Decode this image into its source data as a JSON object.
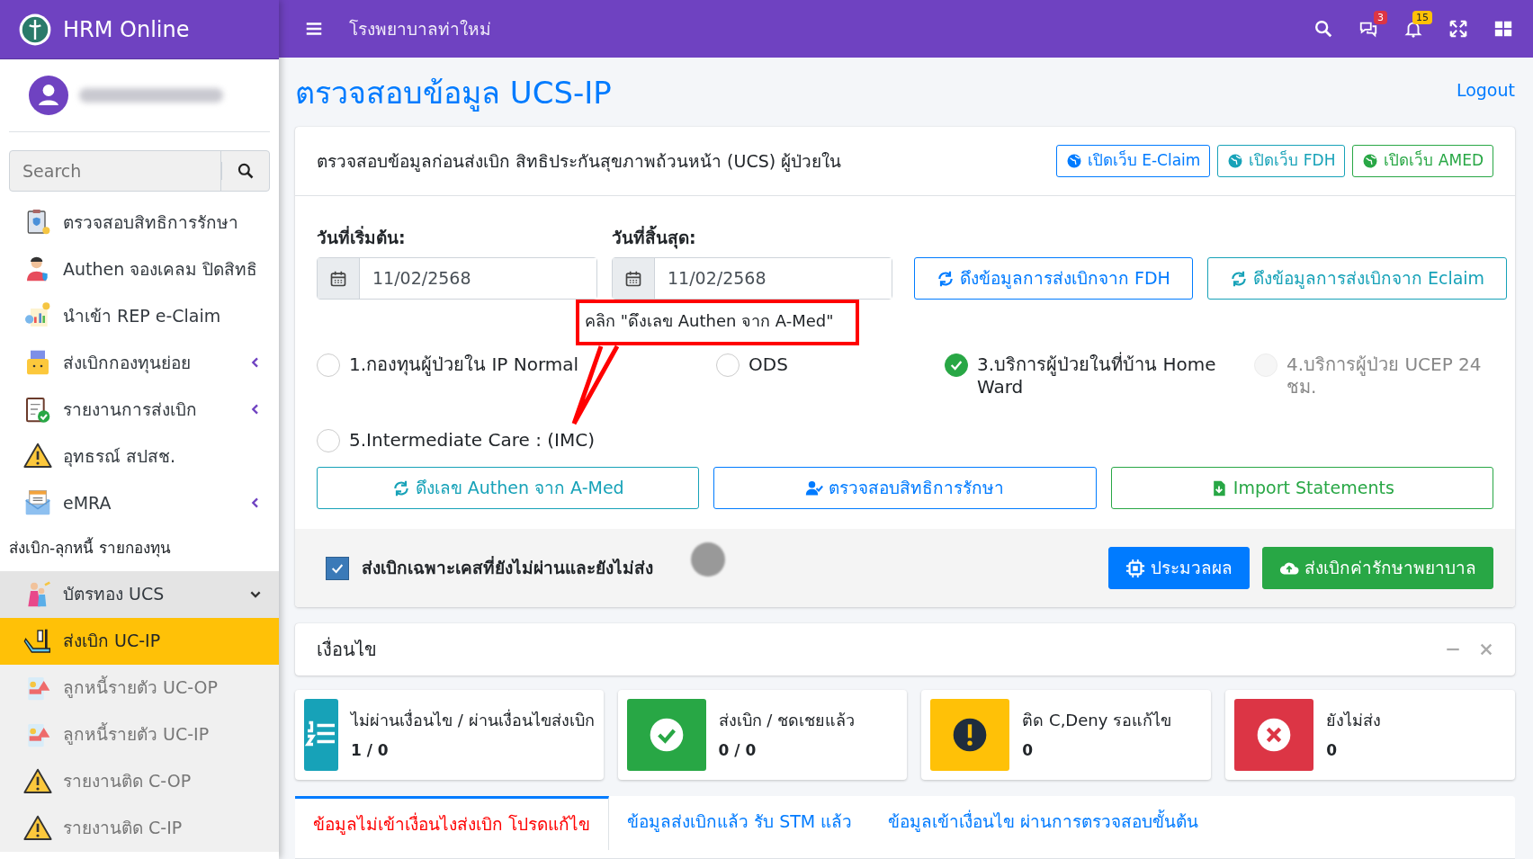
{
  "app": {
    "brand": "HRM Online",
    "hospital": "โรงพยาบาลท่าใหม่"
  },
  "topbar_icons": [
    {
      "kind": "search"
    },
    {
      "kind": "messages",
      "badge": "3",
      "color": "#dc3545"
    },
    {
      "kind": "notifications",
      "badge": "15",
      "color": "#ffc107"
    },
    {
      "kind": "fullscreen"
    },
    {
      "kind": "apps"
    }
  ],
  "sidebar": {
    "search": {
      "placeholder": "Search"
    },
    "items": [
      {
        "label": "ตรวจสอบสิทธิการรักษา",
        "kind": "clipboard"
      },
      {
        "label": "Authen จองเคลม ปิดสิทธิ",
        "kind": "person"
      },
      {
        "label": "นำเข้า REP e-Claim",
        "kind": "chart"
      },
      {
        "label": "ส่งเบิกกองทุนย่อย",
        "kind": "folder",
        "expanded": false
      },
      {
        "label": "รายงานการส่งเบิก",
        "kind": "report",
        "expanded": false
      },
      {
        "label": "อุทธรณ์ สปสช.",
        "kind": "warning"
      },
      {
        "label": "eMRA",
        "kind": "mail",
        "expanded": false
      }
    ],
    "section": "ส่งเบิก-ลุกหนี้ รายกองทุน",
    "group": {
      "label": "บัตรทอง UCS",
      "kind": "family",
      "expanded": true,
      "children": [
        {
          "label": "ส่งเบิก UC-IP",
          "kind": "bed",
          "selected": true
        },
        {
          "label": "ลูกหนี้รายตัว UC-OP",
          "kind": "debt",
          "selected": false
        },
        {
          "label": "ลูกหนี้รายตัว UC-IP",
          "kind": "debt",
          "selected": false
        },
        {
          "label": "รายงานติด C-OP",
          "kind": "warning",
          "selected": false
        },
        {
          "label": "รายงานติด C-IP",
          "kind": "warning",
          "selected": false
        }
      ]
    }
  },
  "page": {
    "title": "ตรวจสอบข้อมูล UCS-IP",
    "logout": "Logout"
  },
  "check_card": {
    "title": "ตรวจสอบข้อมูลก่อนส่งเบิก สิทธิประกันสุขภาพถ้วนหน้า (UCS) ผู้ป่วยใน",
    "links": [
      {
        "label": "เปิดเว็บ E-Claim",
        "kind": "eclaim"
      },
      {
        "label": "เปิดเว็บ FDH",
        "kind": "fdh"
      },
      {
        "label": "เปิดเว็บ AMED",
        "kind": "amed"
      }
    ],
    "start": {
      "label": "วันที่เริ่มต้น:",
      "value": "11/02/2568"
    },
    "end": {
      "label": "วันที่สิ้นสุด:",
      "value": "11/02/2568"
    },
    "fetch_buttons": [
      {
        "label": "ดึงข้อมูลการส่งเบิกจาก FDH",
        "kind": "fdh"
      },
      {
        "label": "ดึงข้อมูลการส่งเบิกจาก Eclaim",
        "kind": "eclaim"
      }
    ],
    "radios": [
      {
        "label": "1.กองทุนผู้ป่วยใน IP Normal",
        "checked": false,
        "disabled": false
      },
      {
        "label": "ODS",
        "checked": false,
        "disabled": false
      },
      {
        "label": "3.บริการผู้ป่วยในที่บ้าน Home Ward",
        "checked": true,
        "disabled": false
      },
      {
        "label": "4.บริการผู้ป่วย UCEP 24 ชม.",
        "checked": false,
        "disabled": true
      },
      {
        "label": "5.Intermediate Care : (IMC)",
        "checked": false,
        "disabled": false
      }
    ],
    "annotation": "คลิก \"ดึงเลข Authen จาก A-Med\"",
    "actions": [
      {
        "label": "ดึงเลข Authen จาก A-Med",
        "kind": "authen"
      },
      {
        "label": "ตรวจสอบสิทธิการรักษา",
        "kind": "rights"
      },
      {
        "label": "Import Statements",
        "kind": "import"
      }
    ],
    "filter": {
      "label": "ส่งเบิกเฉพาะเคสที่ยังไม่ผ่านและยังไม่ส่ง",
      "checked": true
    },
    "submit": [
      {
        "label": "ประมวลผล",
        "kind": "process"
      },
      {
        "label": "ส่งเบิกค่ารักษาพยาบาล",
        "kind": "send"
      }
    ]
  },
  "conditions": {
    "title": "เงื่อนไข",
    "stats": [
      {
        "label": "ไม่ผ่านเงื่อนไข / ผ่านเงื่อนไขส่งเบิก",
        "value": "1 / 0",
        "kind": "list",
        "color": "#17a2b8"
      },
      {
        "label": "ส่งเบิก / ชดเชยแล้ว",
        "value": "0 / 0",
        "kind": "check",
        "color": "#28a745"
      },
      {
        "label": "ติด C,Deny รอแก้ไข",
        "value": "0",
        "kind": "exclaim",
        "color": "#ffc107"
      },
      {
        "label": "ยังไม่ส่ง",
        "value": "0",
        "kind": "cross",
        "color": "#dc3545"
      }
    ],
    "tabs": [
      {
        "label": "ข้อมูลไม่เข้าเงื่อนไงส่งเบิก โปรดแก้ไข",
        "selected": true
      },
      {
        "label": "ข้อมูลส่งเบิกแล้ว รับ STM แล้ว",
        "selected": false
      },
      {
        "label": "ข้อมูลเข้าเงื่อนไข ผ่านการตรวจสอบขั้นต้น",
        "selected": false
      }
    ]
  }
}
